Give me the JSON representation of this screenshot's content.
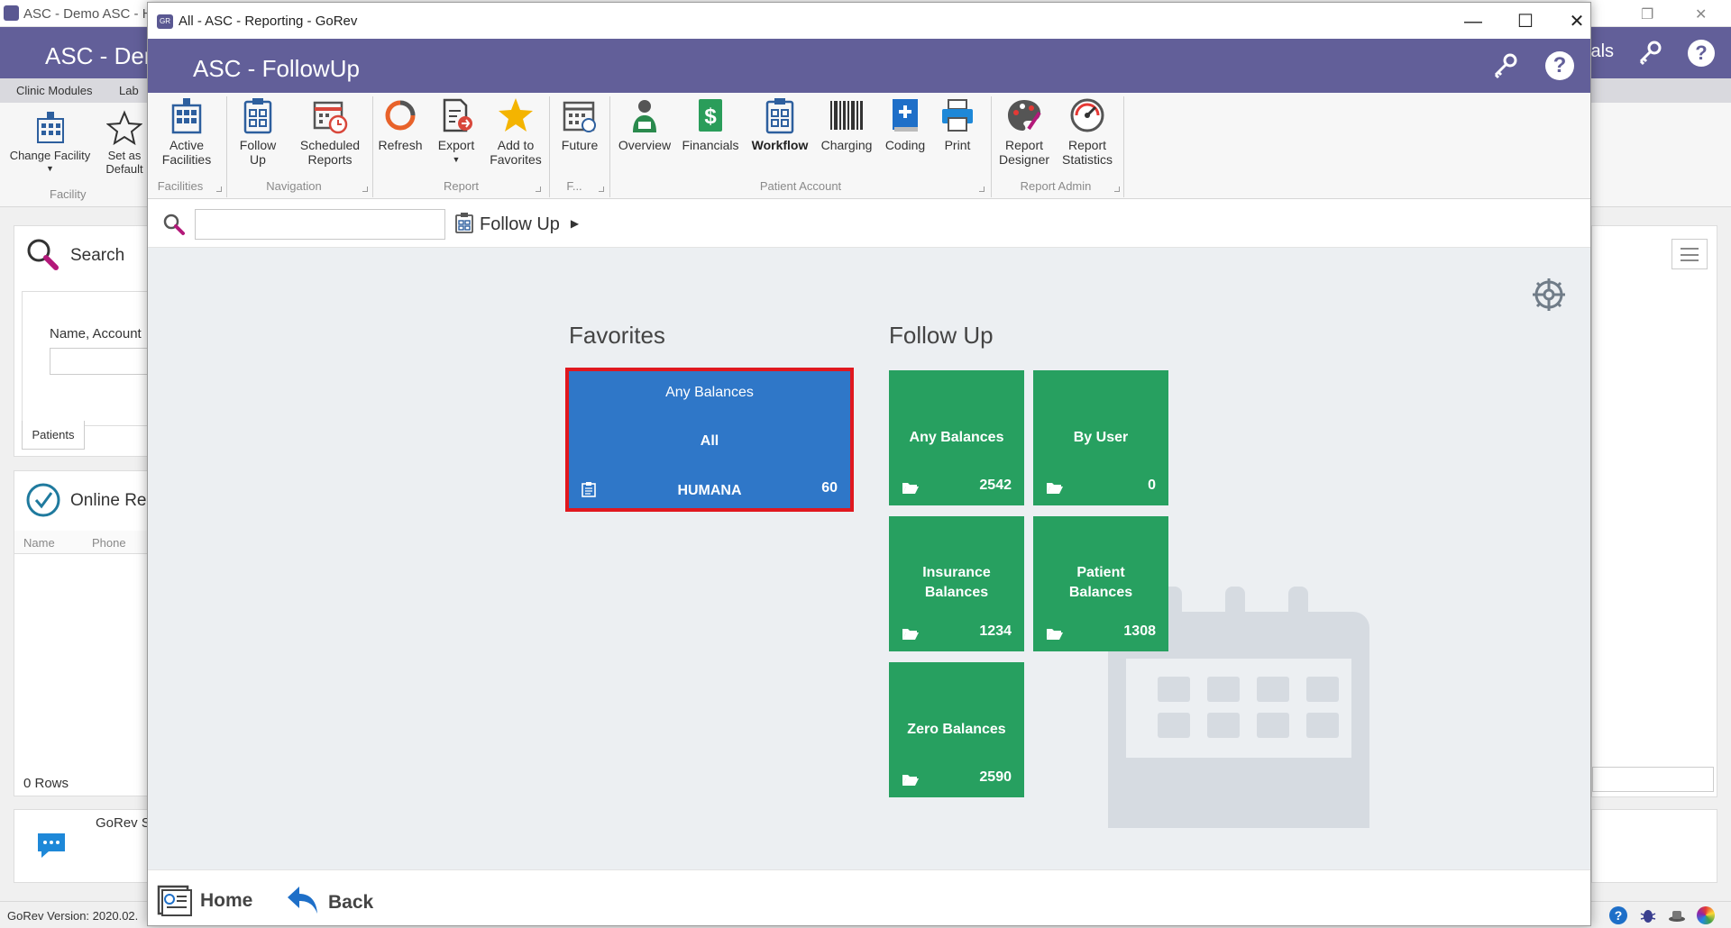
{
  "background_window": {
    "title": "ASC - Demo ASC - H",
    "header_title": "ASC - Der",
    "header_right": "ials",
    "tabs": [
      "Clinic Modules",
      "Lab"
    ],
    "ribbon": {
      "change_facility": "Change Facility",
      "set_as_default": "Set as Default",
      "group_facility": "Facility"
    },
    "search_panel": {
      "title": "Search",
      "field_label": "Name, Account",
      "tab_patients": "Patients"
    },
    "online_panel": {
      "title": "Online Re",
      "col_name": "Name",
      "col_phone": "Phone",
      "rows": "0 Rows"
    },
    "chat_label": "GoRev S",
    "status_version": "GoRev Version: 2020.02."
  },
  "dialog": {
    "window_title": "All - ASC - Reporting - GoRev",
    "header_title": "ASC - FollowUp",
    "ribbon": {
      "buttons": {
        "active_facilities": "Active\nFacilities",
        "follow_up": "Follow\nUp",
        "scheduled_reports": "Scheduled\nReports",
        "refresh": "Refresh",
        "export": "Export",
        "add_to_favorites": "Add to\nFavorites",
        "future": "Future",
        "overview": "Overview",
        "financials": "Financials",
        "workflow": "Workflow",
        "charging": "Charging",
        "coding": "Coding",
        "print": "Print",
        "report_designer": "Report\nDesigner",
        "report_statistics": "Report\nStatistics"
      },
      "groups": {
        "facilities": "Facilities",
        "navigation": "Navigation",
        "report": "Report",
        "future": "F...",
        "patient_account": "Patient Account",
        "report_admin": "Report Admin"
      }
    },
    "toolbar": {
      "search_value": "",
      "breadcrumb": "Follow Up"
    },
    "favorites": {
      "title": "Favorites",
      "tile": {
        "title": "Any Balances",
        "subtitle": "All",
        "payer": "HUMANA",
        "count": "60",
        "color": "#2f77c8",
        "highlight_color": "#e0181f"
      }
    },
    "follow_up": {
      "title": "Follow Up",
      "tiles": [
        {
          "label": "Any Balances",
          "count": "2542"
        },
        {
          "label": "By User",
          "count": "0"
        },
        {
          "label": "Insurance\nBalances",
          "count": "1234"
        },
        {
          "label": "Patient\nBalances",
          "count": "1308"
        },
        {
          "label": "Zero Balances",
          "count": "2590"
        }
      ],
      "color": "#27a060"
    },
    "footer": {
      "home": "Home",
      "back": "Back"
    }
  },
  "colors": {
    "header": "#625f99",
    "tile_green": "#27a060",
    "tile_blue": "#2f77c8",
    "content_bg": "#eceff2"
  }
}
